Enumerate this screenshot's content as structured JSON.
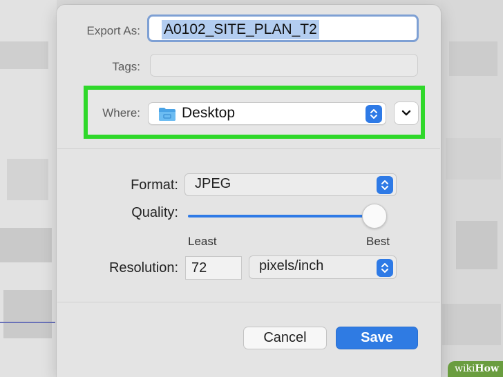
{
  "dialog": {
    "export_as_label": "Export As:",
    "export_as_value": "A0102_SITE_PLAN_T2",
    "tags_label": "Tags:",
    "tags_value": "",
    "where_label": "Where:",
    "where_value": "Desktop",
    "where_icon": "folder-icon",
    "expand_icon": "chevron-down-icon",
    "format_label": "Format:",
    "format_value": "JPEG",
    "quality_label": "Quality:",
    "quality_value": 1.0,
    "quality_min_label": "Least",
    "quality_max_label": "Best",
    "resolution_label": "Resolution:",
    "resolution_value": "72",
    "resolution_unit": "pixels/inch",
    "cancel_label": "Cancel",
    "save_label": "Save"
  },
  "watermark": {
    "left": "wiki",
    "right": "How"
  },
  "colors": {
    "accent": "#2e7ae6",
    "highlight": "#2fd82a",
    "selection": "#b3cdf0",
    "watermark_bg": "#6a9d3f"
  }
}
